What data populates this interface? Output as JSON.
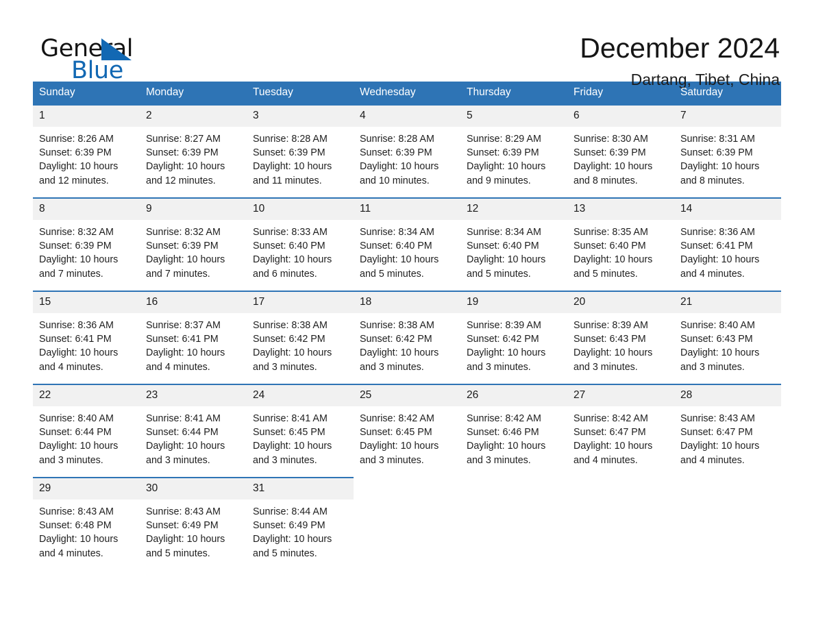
{
  "brand": {
    "name_part1": "General",
    "name_part2": "Blue",
    "triangle_icon": "blue-triangle-icon",
    "accent_color": "#1268b3"
  },
  "header": {
    "title": "December 2024",
    "subtitle": "Dartang, Tibet, China"
  },
  "theme": {
    "header_blue": "#2e74b5",
    "day_band_gray": "#f1f1f1",
    "text_color": "#1a1a1a"
  },
  "calendar": {
    "weekday_headers": [
      "Sunday",
      "Monday",
      "Tuesday",
      "Wednesday",
      "Thursday",
      "Friday",
      "Saturday"
    ],
    "weeks": [
      [
        {
          "day": "1",
          "sunrise": "Sunrise: 8:26 AM",
          "sunset": "Sunset: 6:39 PM",
          "daylight_line1": "Daylight: 10 hours",
          "daylight_line2": "and 12 minutes."
        },
        {
          "day": "2",
          "sunrise": "Sunrise: 8:27 AM",
          "sunset": "Sunset: 6:39 PM",
          "daylight_line1": "Daylight: 10 hours",
          "daylight_line2": "and 12 minutes."
        },
        {
          "day": "3",
          "sunrise": "Sunrise: 8:28 AM",
          "sunset": "Sunset: 6:39 PM",
          "daylight_line1": "Daylight: 10 hours",
          "daylight_line2": "and 11 minutes."
        },
        {
          "day": "4",
          "sunrise": "Sunrise: 8:28 AM",
          "sunset": "Sunset: 6:39 PM",
          "daylight_line1": "Daylight: 10 hours",
          "daylight_line2": "and 10 minutes."
        },
        {
          "day": "5",
          "sunrise": "Sunrise: 8:29 AM",
          "sunset": "Sunset: 6:39 PM",
          "daylight_line1": "Daylight: 10 hours",
          "daylight_line2": "and 9 minutes."
        },
        {
          "day": "6",
          "sunrise": "Sunrise: 8:30 AM",
          "sunset": "Sunset: 6:39 PM",
          "daylight_line1": "Daylight: 10 hours",
          "daylight_line2": "and 8 minutes."
        },
        {
          "day": "7",
          "sunrise": "Sunrise: 8:31 AM",
          "sunset": "Sunset: 6:39 PM",
          "daylight_line1": "Daylight: 10 hours",
          "daylight_line2": "and 8 minutes."
        }
      ],
      [
        {
          "day": "8",
          "sunrise": "Sunrise: 8:32 AM",
          "sunset": "Sunset: 6:39 PM",
          "daylight_line1": "Daylight: 10 hours",
          "daylight_line2": "and 7 minutes."
        },
        {
          "day": "9",
          "sunrise": "Sunrise: 8:32 AM",
          "sunset": "Sunset: 6:39 PM",
          "daylight_line1": "Daylight: 10 hours",
          "daylight_line2": "and 7 minutes."
        },
        {
          "day": "10",
          "sunrise": "Sunrise: 8:33 AM",
          "sunset": "Sunset: 6:40 PM",
          "daylight_line1": "Daylight: 10 hours",
          "daylight_line2": "and 6 minutes."
        },
        {
          "day": "11",
          "sunrise": "Sunrise: 8:34 AM",
          "sunset": "Sunset: 6:40 PM",
          "daylight_line1": "Daylight: 10 hours",
          "daylight_line2": "and 5 minutes."
        },
        {
          "day": "12",
          "sunrise": "Sunrise: 8:34 AM",
          "sunset": "Sunset: 6:40 PM",
          "daylight_line1": "Daylight: 10 hours",
          "daylight_line2": "and 5 minutes."
        },
        {
          "day": "13",
          "sunrise": "Sunrise: 8:35 AM",
          "sunset": "Sunset: 6:40 PM",
          "daylight_line1": "Daylight: 10 hours",
          "daylight_line2": "and 5 minutes."
        },
        {
          "day": "14",
          "sunrise": "Sunrise: 8:36 AM",
          "sunset": "Sunset: 6:41 PM",
          "daylight_line1": "Daylight: 10 hours",
          "daylight_line2": "and 4 minutes."
        }
      ],
      [
        {
          "day": "15",
          "sunrise": "Sunrise: 8:36 AM",
          "sunset": "Sunset: 6:41 PM",
          "daylight_line1": "Daylight: 10 hours",
          "daylight_line2": "and 4 minutes."
        },
        {
          "day": "16",
          "sunrise": "Sunrise: 8:37 AM",
          "sunset": "Sunset: 6:41 PM",
          "daylight_line1": "Daylight: 10 hours",
          "daylight_line2": "and 4 minutes."
        },
        {
          "day": "17",
          "sunrise": "Sunrise: 8:38 AM",
          "sunset": "Sunset: 6:42 PM",
          "daylight_line1": "Daylight: 10 hours",
          "daylight_line2": "and 3 minutes."
        },
        {
          "day": "18",
          "sunrise": "Sunrise: 8:38 AM",
          "sunset": "Sunset: 6:42 PM",
          "daylight_line1": "Daylight: 10 hours",
          "daylight_line2": "and 3 minutes."
        },
        {
          "day": "19",
          "sunrise": "Sunrise: 8:39 AM",
          "sunset": "Sunset: 6:42 PM",
          "daylight_line1": "Daylight: 10 hours",
          "daylight_line2": "and 3 minutes."
        },
        {
          "day": "20",
          "sunrise": "Sunrise: 8:39 AM",
          "sunset": "Sunset: 6:43 PM",
          "daylight_line1": "Daylight: 10 hours",
          "daylight_line2": "and 3 minutes."
        },
        {
          "day": "21",
          "sunrise": "Sunrise: 8:40 AM",
          "sunset": "Sunset: 6:43 PM",
          "daylight_line1": "Daylight: 10 hours",
          "daylight_line2": "and 3 minutes."
        }
      ],
      [
        {
          "day": "22",
          "sunrise": "Sunrise: 8:40 AM",
          "sunset": "Sunset: 6:44 PM",
          "daylight_line1": "Daylight: 10 hours",
          "daylight_line2": "and 3 minutes."
        },
        {
          "day": "23",
          "sunrise": "Sunrise: 8:41 AM",
          "sunset": "Sunset: 6:44 PM",
          "daylight_line1": "Daylight: 10 hours",
          "daylight_line2": "and 3 minutes."
        },
        {
          "day": "24",
          "sunrise": "Sunrise: 8:41 AM",
          "sunset": "Sunset: 6:45 PM",
          "daylight_line1": "Daylight: 10 hours",
          "daylight_line2": "and 3 minutes."
        },
        {
          "day": "25",
          "sunrise": "Sunrise: 8:42 AM",
          "sunset": "Sunset: 6:45 PM",
          "daylight_line1": "Daylight: 10 hours",
          "daylight_line2": "and 3 minutes."
        },
        {
          "day": "26",
          "sunrise": "Sunrise: 8:42 AM",
          "sunset": "Sunset: 6:46 PM",
          "daylight_line1": "Daylight: 10 hours",
          "daylight_line2": "and 3 minutes."
        },
        {
          "day": "27",
          "sunrise": "Sunrise: 8:42 AM",
          "sunset": "Sunset: 6:47 PM",
          "daylight_line1": "Daylight: 10 hours",
          "daylight_line2": "and 4 minutes."
        },
        {
          "day": "28",
          "sunrise": "Sunrise: 8:43 AM",
          "sunset": "Sunset: 6:47 PM",
          "daylight_line1": "Daylight: 10 hours",
          "daylight_line2": "and 4 minutes."
        }
      ],
      [
        {
          "day": "29",
          "sunrise": "Sunrise: 8:43 AM",
          "sunset": "Sunset: 6:48 PM",
          "daylight_line1": "Daylight: 10 hours",
          "daylight_line2": "and 4 minutes."
        },
        {
          "day": "30",
          "sunrise": "Sunrise: 8:43 AM",
          "sunset": "Sunset: 6:49 PM",
          "daylight_line1": "Daylight: 10 hours",
          "daylight_line2": "and 5 minutes."
        },
        {
          "day": "31",
          "sunrise": "Sunrise: 8:44 AM",
          "sunset": "Sunset: 6:49 PM",
          "daylight_line1": "Daylight: 10 hours",
          "daylight_line2": "and 5 minutes."
        },
        null,
        null,
        null,
        null
      ]
    ]
  }
}
